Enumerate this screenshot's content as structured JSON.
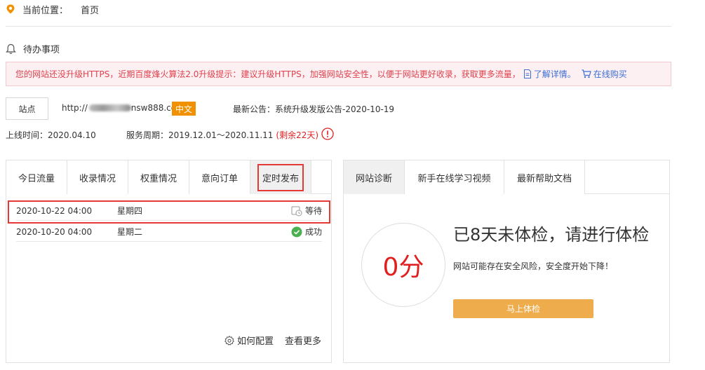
{
  "breadcrumb": {
    "label": "当前位置：",
    "current": "首页"
  },
  "todo": {
    "title": "待办事项"
  },
  "alert": {
    "message": "您的网站还没升级HTTPS，近期百度烽火算法2.0升级提示：建议升级HTTPS，加强网站安全性，以便于网站更好收录，获取更多流量，",
    "learn_more": "了解详情。",
    "buy_online": "在线购买"
  },
  "site": {
    "button": "站点",
    "url_prefix": "http://",
    "url_suffix": "nsw888.com",
    "lang": "中文",
    "notice": "最新公告：系统升级发版公告-2020-10-19",
    "online_date": "上线时间：2020.04.10",
    "service_period": "服务周期：2019.12.01～2020.11.11",
    "remaining": "(剩余22天)"
  },
  "left_panel": {
    "tabs": [
      "今日流量",
      "收录情况",
      "权重情况",
      "意向订单",
      "定时发布"
    ],
    "rows": [
      {
        "date": "2020-10-22 04:00",
        "weekday": "星期四",
        "status": "等待"
      },
      {
        "date": "2020-10-20 04:00",
        "weekday": "星期二",
        "status": "成功"
      }
    ],
    "how_to_config": "如何配置",
    "view_more": "查看更多"
  },
  "right_panel": {
    "tabs": [
      "网站诊断",
      "新手在线学习视频",
      "最新帮助文档"
    ],
    "score": "0分",
    "title": "已8天未体检，请进行体检",
    "subtitle": "网站可能存在安全风险，安全度开始下降！",
    "check_button": "马上体检"
  },
  "colors": {
    "accent_orange": "#f29100",
    "alert_red": "#e0414d",
    "link_blue": "#3b6fd6",
    "button_orange": "#efac4d",
    "success_green": "#4caf50",
    "highlight_red": "#e53935"
  }
}
